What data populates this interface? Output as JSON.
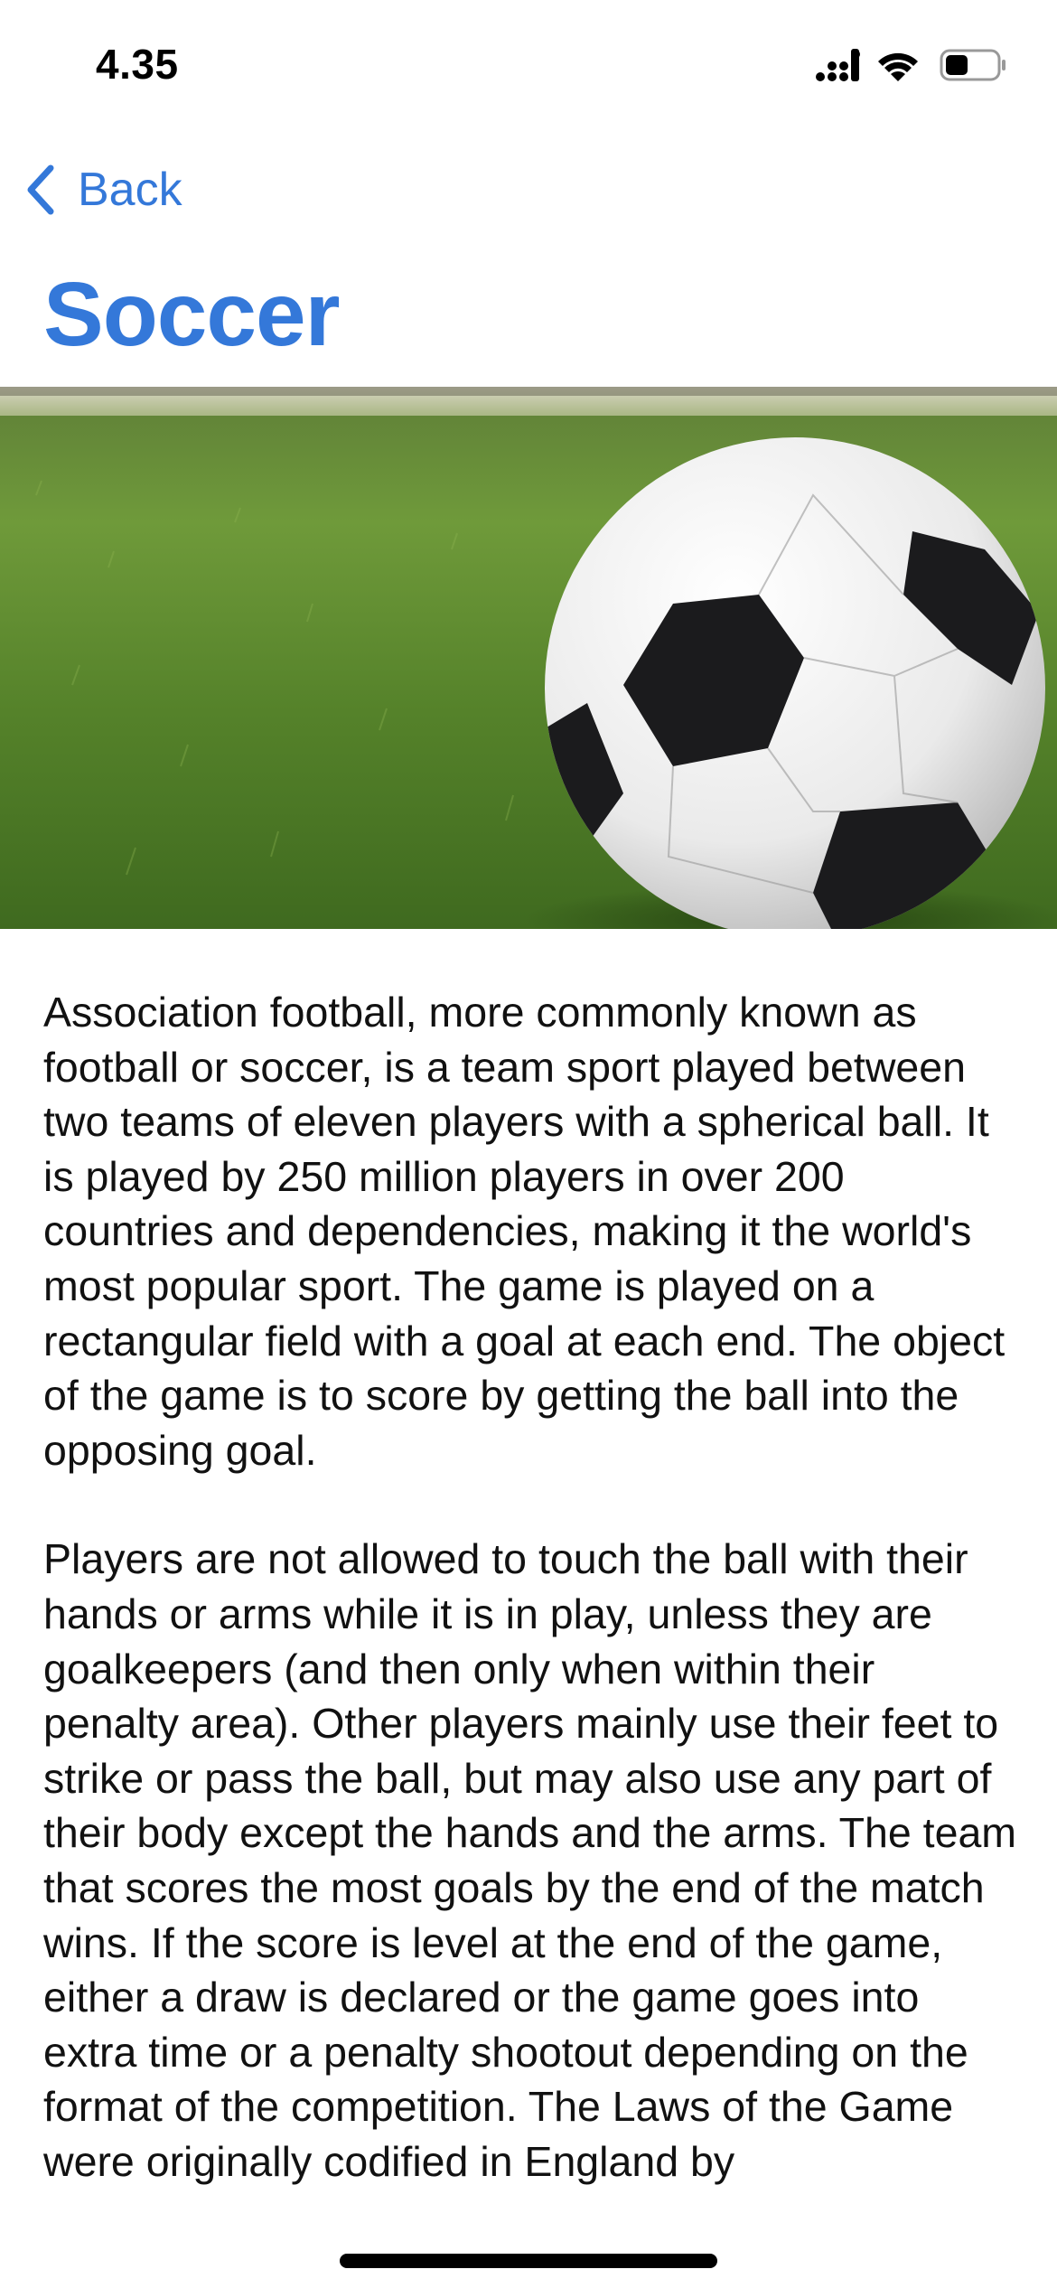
{
  "status_bar": {
    "time": "4.35",
    "icons": [
      "cellular-signal-icon",
      "wifi-icon",
      "battery-icon"
    ]
  },
  "nav": {
    "back_label": "Back",
    "back_icon": "chevron-left-icon"
  },
  "page": {
    "title": "Soccer",
    "hero_image": "soccer-ball-on-grass",
    "paragraphs": [
      "Association football, more commonly known as football or soccer, is a team sport played between two teams of eleven players with a spherical ball. It is played by 250 million players in over 200 countries and dependencies, making it the world's most popular sport. The game is played on a rectangular field with a goal at each end. The object of the game is to score by getting the ball into the opposing goal.",
      "Players are not allowed to touch the ball with their hands or arms while it is in play, unless they are goalkeepers (and then only when within their penalty area). Other players mainly use their feet to strike or pass the ball, but may also use any part of their body except the hands and the arms. The team that scores the most goals by the end of the match wins. If the score is level at the end of the game, either a draw is declared or the game goes into extra time or a penalty shootout depending on the format of the competition. The Laws of the Game were originally codified in England by"
    ]
  },
  "colors": {
    "accent": "#3478d9",
    "text": "#111111",
    "background": "#ffffff"
  }
}
